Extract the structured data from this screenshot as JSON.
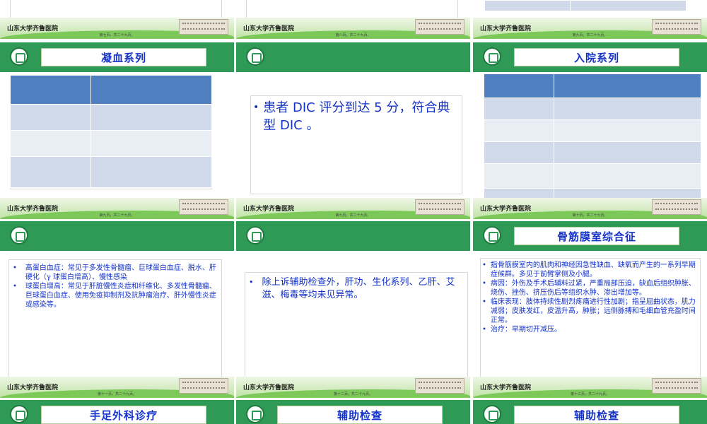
{
  "school_name": "山东大学齐鲁医院",
  "slides": {
    "s1": {
      "page": "第七页，共二十九页。"
    },
    "s2": {
      "page": "第八页，共二十九页。"
    },
    "s3": {
      "page": "第九页，共二十九页。"
    },
    "s4": {
      "title": "凝血系列",
      "page": "第九页，共二十九页。"
    },
    "s5": {
      "page": "第九页，共二十九页。",
      "bullet": "患者 DIC 评分到达 5 分，符合典型 DIC 。"
    },
    "s6": {
      "title": "入院系列",
      "page": "第十页，共二十九页。"
    },
    "s7": {
      "page": "第十一页，共二十九页。",
      "bullets": [
        "高蛋白血症：常见于多发性骨髓瘤、巨球蛋白血症、脱水、肝硬化（γ 球蛋白增高）、慢性感染",
        "球蛋白增高：常见于肝脏慢性炎症和纤维化、多发性骨髓瘤、巨球蛋白血症、使用免疫抑制剂及抗肿瘤治疗、肝外慢性炎症或感染等。"
      ]
    },
    "s8": {
      "page": "第十二页，共二十九页。",
      "bullet": "除上诉辅助检查外，肝功、生化系列、乙肝、艾滋、梅毒等均未见异常。"
    },
    "s9": {
      "title": "骨筋膜室综合征",
      "page": "第十三页，共二十九页。",
      "bullets": [
        "指骨筋膜室内的肌肉和神经因急性缺血、缺氧而产生的一系列早期症候群。多见于前臂掌侧及小腿。",
        "病因：外伤及手术后辅料过紧，严重局部压迫，缺血后组织肿胀、烧伤、挫伤、挤压伤后等组织水肿、渗出增加等。",
        "临床表现：肢体持续性剧烈疼痛进行性加剧；指呈屈曲状态，肌力减弱；皮肤发红，皮温升高，肿胀；远侧脉搏和毛细血管充盈时间正常。",
        "治疗：早期切开减压。"
      ]
    },
    "s10": {
      "title": "手足外科诊疗"
    },
    "s11": {
      "title": "辅助检查"
    },
    "s12": {
      "title": "辅助检查"
    }
  },
  "bullet_glyph": "•",
  "colors": {
    "header_green": "#2e9a55",
    "title_blue": "#1533c8",
    "table_head": "#4f7fbf",
    "table_row_a": "#d0d9ea",
    "table_row_b": "#e9edf4"
  }
}
